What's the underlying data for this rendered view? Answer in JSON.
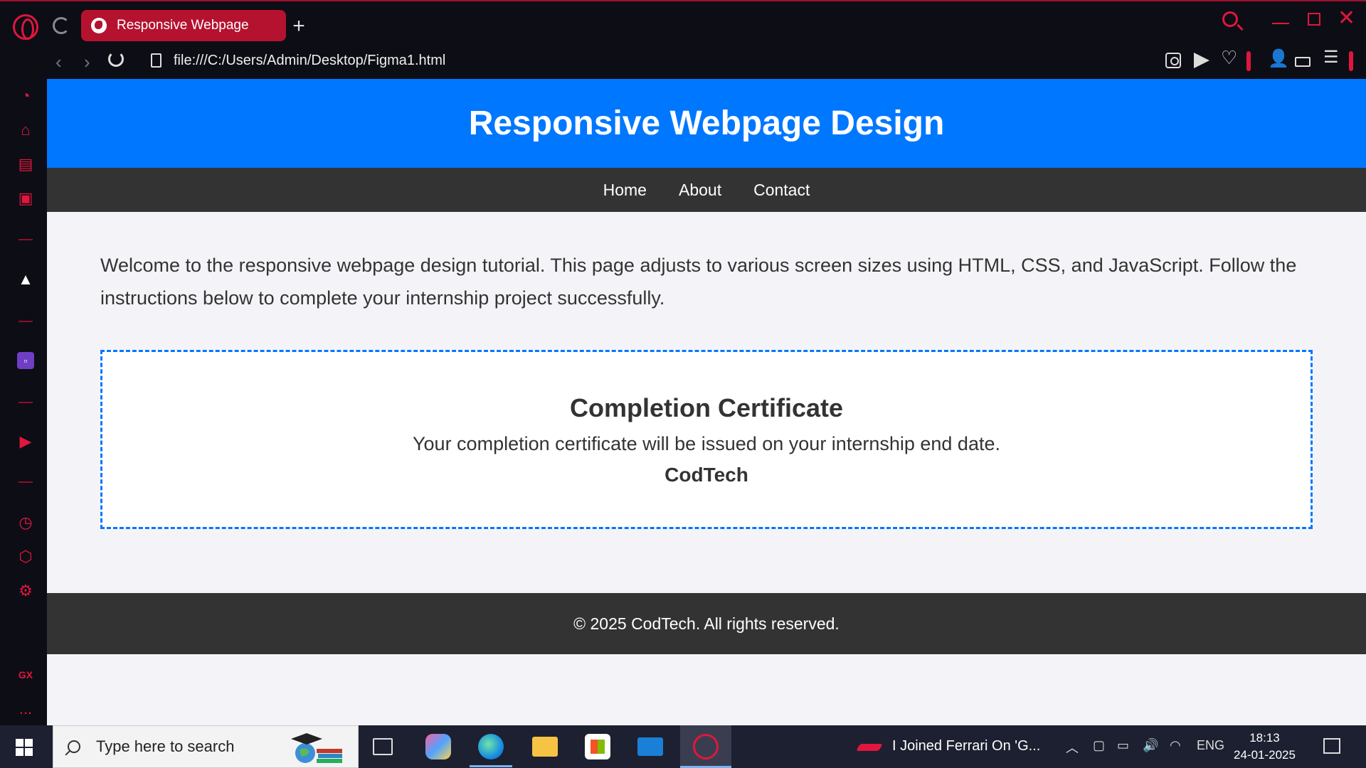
{
  "browser": {
    "tab_title": "Responsive Webpage",
    "url": "file:///C:/Users/Admin/Desktop/Figma1.html"
  },
  "page": {
    "header_title": "Responsive Webpage Design",
    "nav": [
      {
        "label": "Home"
      },
      {
        "label": "About"
      },
      {
        "label": "Contact"
      }
    ],
    "intro_text": "Welcome to the responsive webpage design tutorial. This page adjusts to various screen sizes using HTML, CSS, and JavaScript. Follow the instructions below to complete your internship project successfully.",
    "certificate": {
      "heading": "Completion Certificate",
      "message": "Your completion certificate will be issued on your internship end date.",
      "company": "CodTech"
    },
    "footer_text": "© 2025 CodTech. All rights reserved."
  },
  "sidebar": {
    "gx_label": "GX",
    "more_label": "..."
  },
  "taskbar": {
    "search_placeholder": "Type here to search",
    "news_text": "I Joined Ferrari On 'G...",
    "language": "ENG",
    "time": "18:13",
    "date": "24-01-2025"
  },
  "colors": {
    "accent": "#e0163f",
    "header_blue": "#0077ff",
    "nav_dark": "#333333"
  }
}
